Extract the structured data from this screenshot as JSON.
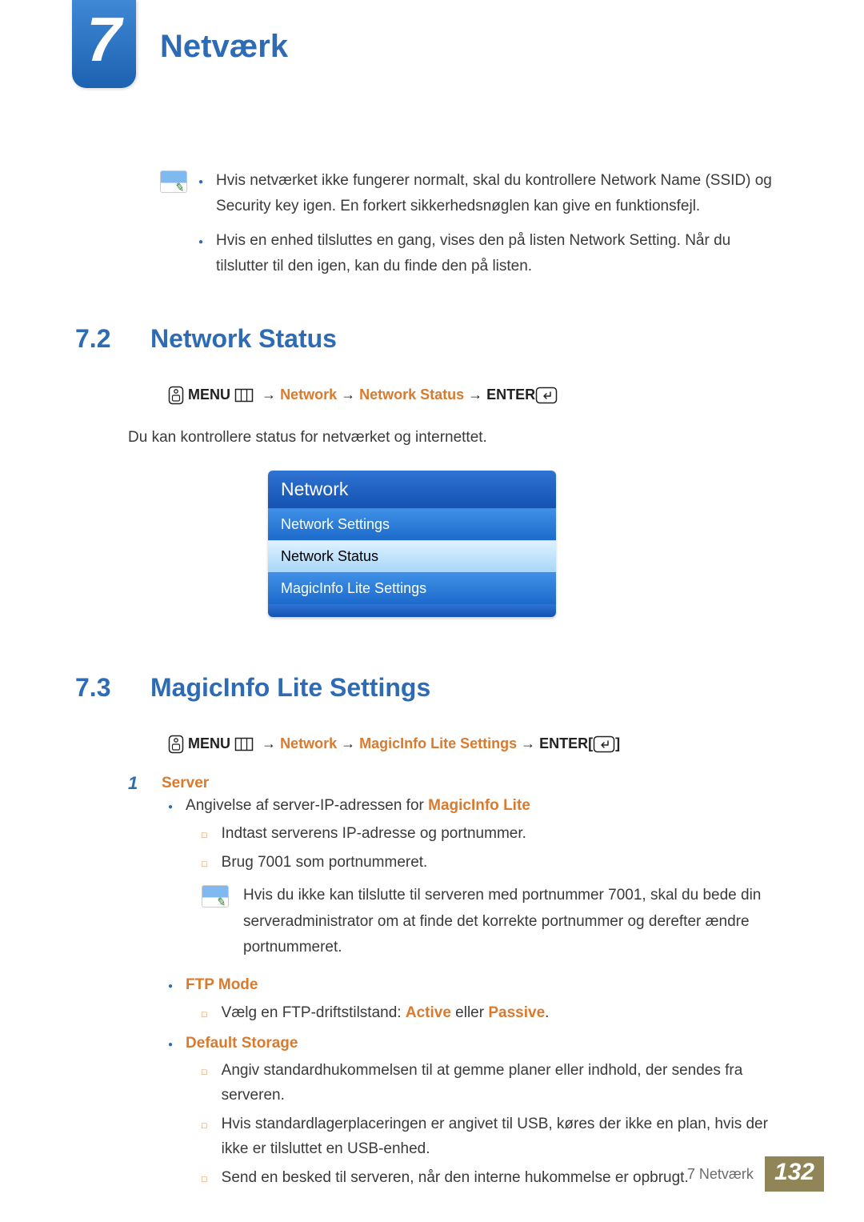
{
  "chapter": {
    "number": "7",
    "title": "Netværk"
  },
  "top_note": {
    "items": [
      "Hvis netværket ikke fungerer normalt, skal du kontrollere Network Name (SSID) og Security key igen. En forkert sikkerhedsnøglen kan give en funktionsfejl.",
      "Hvis en enhed tilsluttes en gang, vises den på listen Network Setting. Når du tilslutter til den igen, kan du finde den på listen."
    ]
  },
  "section_72": {
    "number": "7.2",
    "title": "Network Status",
    "menu_label": "MENU",
    "nav_1": "Network",
    "nav_2": "Network Status",
    "enter_label": "ENTER",
    "arrow": "→",
    "para": "Du kan kontrollere status for netværket og internettet."
  },
  "osd": {
    "header": "Network",
    "items": [
      {
        "label": "Network Settings",
        "selected": false
      },
      {
        "label": "Network Status",
        "selected": true
      },
      {
        "label": "MagicInfo Lite Settings",
        "selected": false
      }
    ]
  },
  "section_73": {
    "number": "7.3",
    "title": "MagicInfo Lite Settings",
    "menu_label": "MENU",
    "nav_1": "Network",
    "nav_2": "MagicInfo Lite Settings",
    "enter_label": "ENTER",
    "enter_bracket_open": "[",
    "enter_bracket_close": "]",
    "arrow": "→",
    "step1_num": "1",
    "step1_label": "Server",
    "server_line_prefix": "Angivelse af server-IP-adressen for ",
    "server_line_bold": "MagicInfo Lite",
    "server_sq1": "Indtast serverens IP-adresse og portnummer.",
    "server_sq2": "Brug 7001 som portnummeret.",
    "server_note": "Hvis du ikke kan tilslutte til serveren med portnummer 7001, skal du bede din serveradministrator om at finde det korrekte portnummer og derefter ændre portnummeret.",
    "ftp_label": "FTP Mode",
    "ftp_line_prefix": "Vælg en FTP-driftstilstand: ",
    "ftp_active": "Active",
    "ftp_or": " eller ",
    "ftp_passive": "Passive",
    "default_storage_label": "Default Storage",
    "ds_sq1": "Angiv standardhukommelsen til at gemme planer eller indhold, der sendes fra serveren.",
    "ds_sq2": "Hvis standardlagerplaceringen er angivet til USB, køres der ikke en plan, hvis der ikke er tilsluttet en USB-enhed.",
    "ds_sq3": "Send en besked til serveren, når den interne hukommelse er opbrugt."
  },
  "footer": {
    "chapter_label": "7 Netværk",
    "page": "132"
  }
}
